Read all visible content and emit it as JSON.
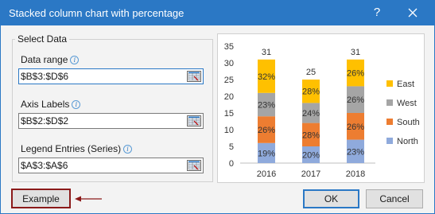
{
  "window": {
    "title": "Stacked column chart with percentage",
    "help_label": "?",
    "accent_color": "#2b78c5"
  },
  "select_data": {
    "group_label": "Select Data",
    "data_range": {
      "label": "Data range",
      "value": "$B$3:$D$6"
    },
    "axis_labels": {
      "label": "Axis Labels",
      "value": "$B$2:$D$2"
    },
    "legend_entries": {
      "label": "Legend Entries (Series)",
      "value": "$A$3:$A$6"
    }
  },
  "buttons": {
    "example": "Example",
    "ok": "OK",
    "cancel": "Cancel"
  },
  "chart_data": {
    "type": "bar",
    "stacked": true,
    "categories": [
      "2016",
      "2017",
      "2018"
    ],
    "ylim": [
      0,
      35
    ],
    "yticks": [
      "0",
      "5",
      "10",
      "15",
      "20",
      "25",
      "30",
      "35"
    ],
    "totals": [
      "31",
      "25",
      "31"
    ],
    "series": [
      {
        "name": "North",
        "color": "#8faadc",
        "values": [
          6,
          5,
          7
        ],
        "labels": [
          "19%",
          "20%",
          "23%"
        ]
      },
      {
        "name": "South",
        "color": "#ed7d31",
        "values": [
          8,
          7,
          8
        ],
        "labels": [
          "26%",
          "28%",
          "26%"
        ]
      },
      {
        "name": "West",
        "color": "#a5a5a5",
        "values": [
          7,
          6,
          8
        ],
        "labels": [
          "23%",
          "24%",
          "26%"
        ]
      },
      {
        "name": "East",
        "color": "#ffc000",
        "values": [
          10,
          7,
          8
        ],
        "labels": [
          "32%",
          "28%",
          "26%"
        ]
      }
    ],
    "legend": [
      "East",
      "West",
      "South",
      "North"
    ],
    "grid": false
  }
}
